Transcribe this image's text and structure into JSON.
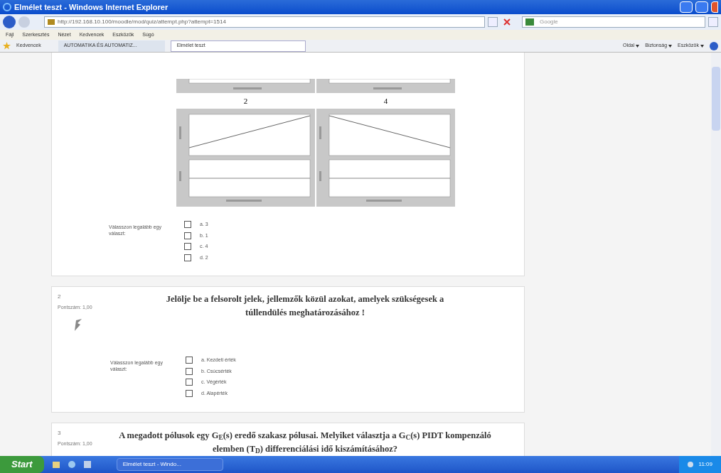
{
  "window": {
    "title": "Elmélet teszt - Windows Internet Explorer"
  },
  "address_bar": {
    "url": "http://192.168.10.100/moodle/mod/quiz/attempt.php?attempt=1514",
    "search_placeholder": "Google"
  },
  "menu": [
    "Fájl",
    "Szerkesztés",
    "Nézet",
    "Kedvencek",
    "Eszközök",
    "Súgó"
  ],
  "favorites_label": "Kedvencek",
  "tabs": [
    {
      "label": "AUTOMATIKA ÉS AUTOMATIZ...",
      "selected": false
    },
    {
      "label": "Elmélet teszt",
      "selected": true
    }
  ],
  "command_bar": [
    "Oldal",
    "Biztonság",
    "Eszközök"
  ],
  "questions": [
    {
      "plot_labels": [
        "2",
        "4"
      ],
      "prompt": "Válasszon legalább egy választ:",
      "options": [
        {
          "label": "a. 3",
          "checked": false
        },
        {
          "label": "b. 1",
          "checked": false
        },
        {
          "label": "c. 4",
          "checked": false
        },
        {
          "label": "d. 2",
          "checked": false
        }
      ]
    },
    {
      "number": "2",
      "points": "Pontszám: 1,00",
      "title": "Jelölje be a felsorolt jelek, jellemzők közül azokat, amelyek szükségesek a túllendülés meghatározásához !",
      "prompt": "Válasszon legalább egy választ:",
      "options": [
        {
          "label": "a. Kezdeti érték",
          "checked": false
        },
        {
          "label": "b. Csúcsérték",
          "checked": false
        },
        {
          "label": "c. Végérték",
          "checked": false
        },
        {
          "label": "d. Alapérték",
          "checked": false
        }
      ]
    },
    {
      "number": "3",
      "points": "Pontszám: 1,00",
      "title": "A megadott pólusok egy G$_{E}$(s) eredő szakasz pólusai. Melyiket választja a G$_{C}$(s) PIDT kompenzáló elemben (T$_{D}$) differenciálási idő kiszámításához?"
    }
  ],
  "taskbar": {
    "start": "Start",
    "task": "Elmélet teszt - Windo...",
    "clock": "11:09"
  }
}
